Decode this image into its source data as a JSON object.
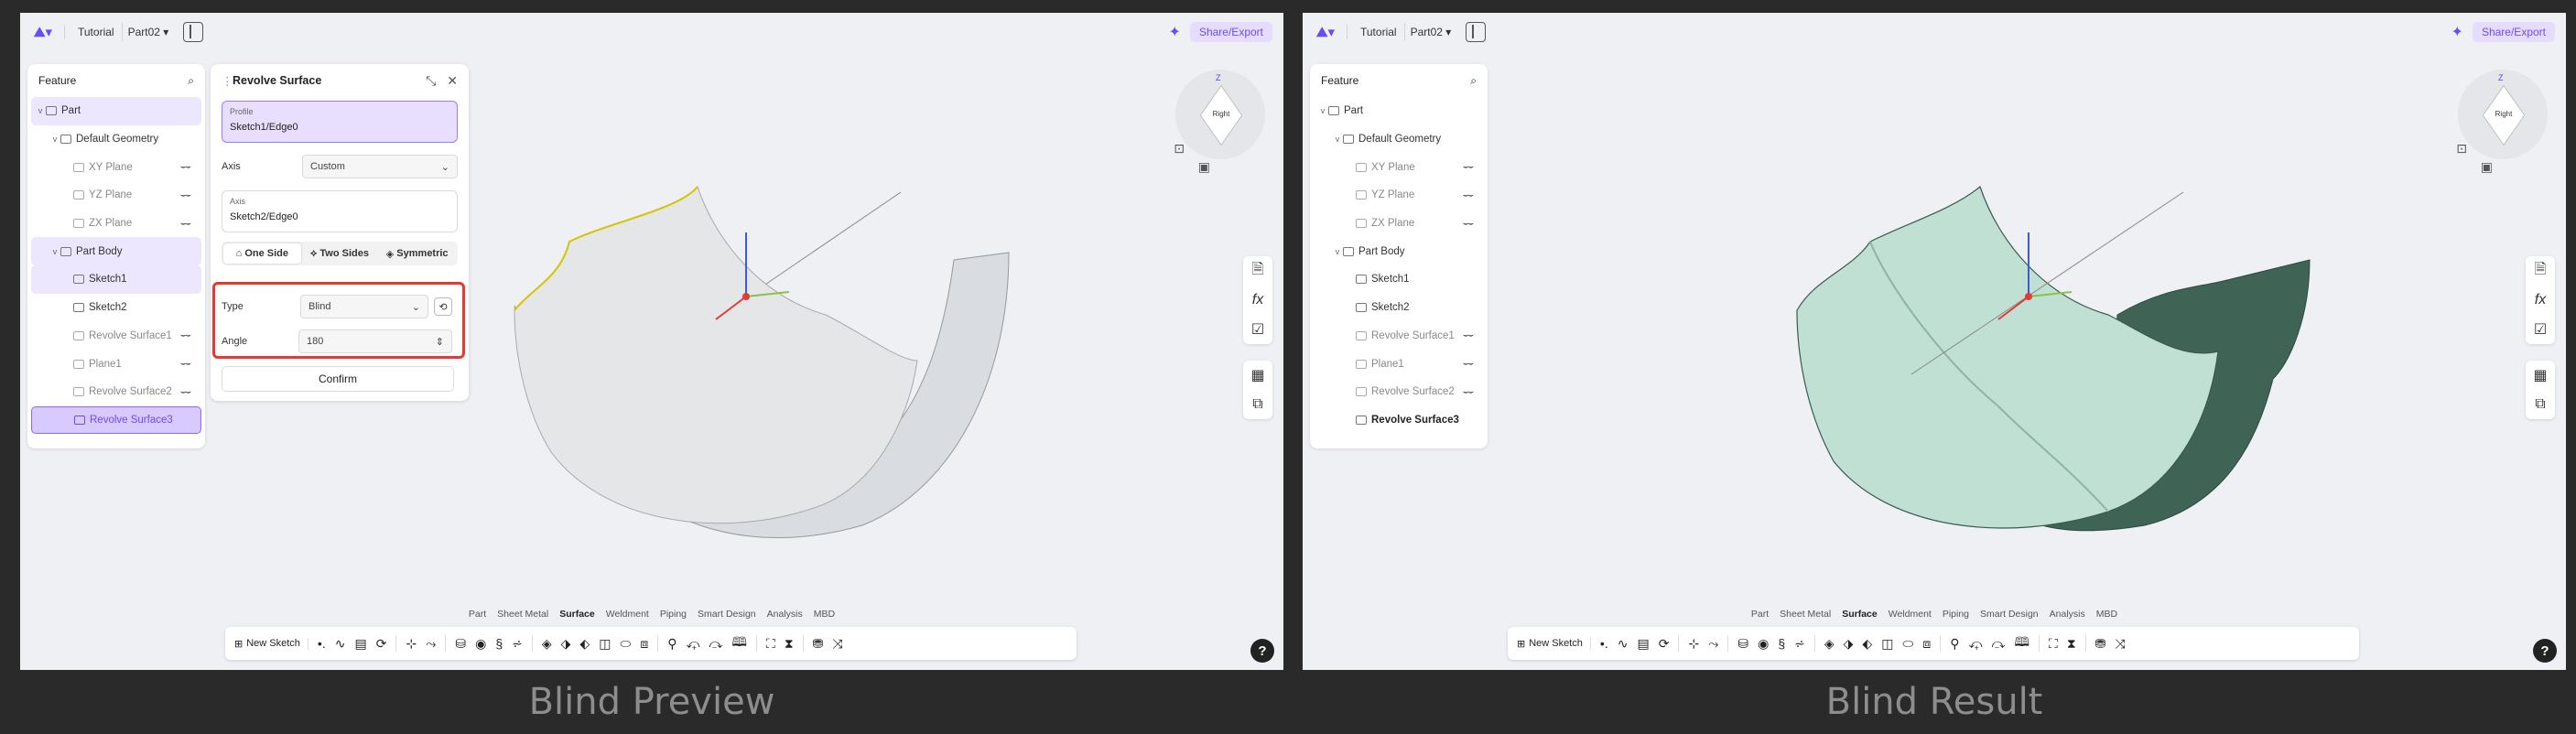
{
  "colors": {
    "accent": "#6a4cf5",
    "highlight": "#e53935",
    "surface_result": "#bfe0d3"
  },
  "topbar": {
    "crumbs": [
      "Tutorial",
      "Part02"
    ],
    "share_label": "Share/Export"
  },
  "tree": {
    "title": "Feature",
    "items": [
      {
        "label": "Part"
      },
      {
        "label": "Default Geometry"
      },
      {
        "label": "XY Plane"
      },
      {
        "label": "YZ Plane"
      },
      {
        "label": "ZX Plane"
      },
      {
        "label": "Part Body"
      },
      {
        "label": "Sketch1"
      },
      {
        "label": "Sketch2"
      },
      {
        "label": "Revolve Surface1"
      },
      {
        "label": "Plane1"
      },
      {
        "label": "Revolve Surface2"
      },
      {
        "label": "Revolve Surface3"
      }
    ]
  },
  "dialog": {
    "title": "Revolve Surface",
    "profile_label": "Profile",
    "profile_value": "Sketch1/Edge0",
    "axis_label": "Axis",
    "axis_select": "Custom",
    "axis_field_label": "Axis",
    "axis_field_value": "Sketch2/Edge0",
    "seg_one": "One Side",
    "seg_two": "Two Sides",
    "seg_sym": "Symmetric",
    "type_label": "Type",
    "type_value": "Blind",
    "angle_label": "Angle",
    "angle_value": "180",
    "confirm": "Confirm"
  },
  "viewcube": {
    "z_label": "Z",
    "face_label": "Right"
  },
  "tabs": [
    "Part",
    "Sheet Metal",
    "Surface",
    "Weldment",
    "Piping",
    "Smart Design",
    "Analysis",
    "MBD"
  ],
  "toolbar": {
    "new_sketch": "New Sketch"
  },
  "captions": {
    "left": "Blind Preview",
    "right": "Blind Result"
  }
}
